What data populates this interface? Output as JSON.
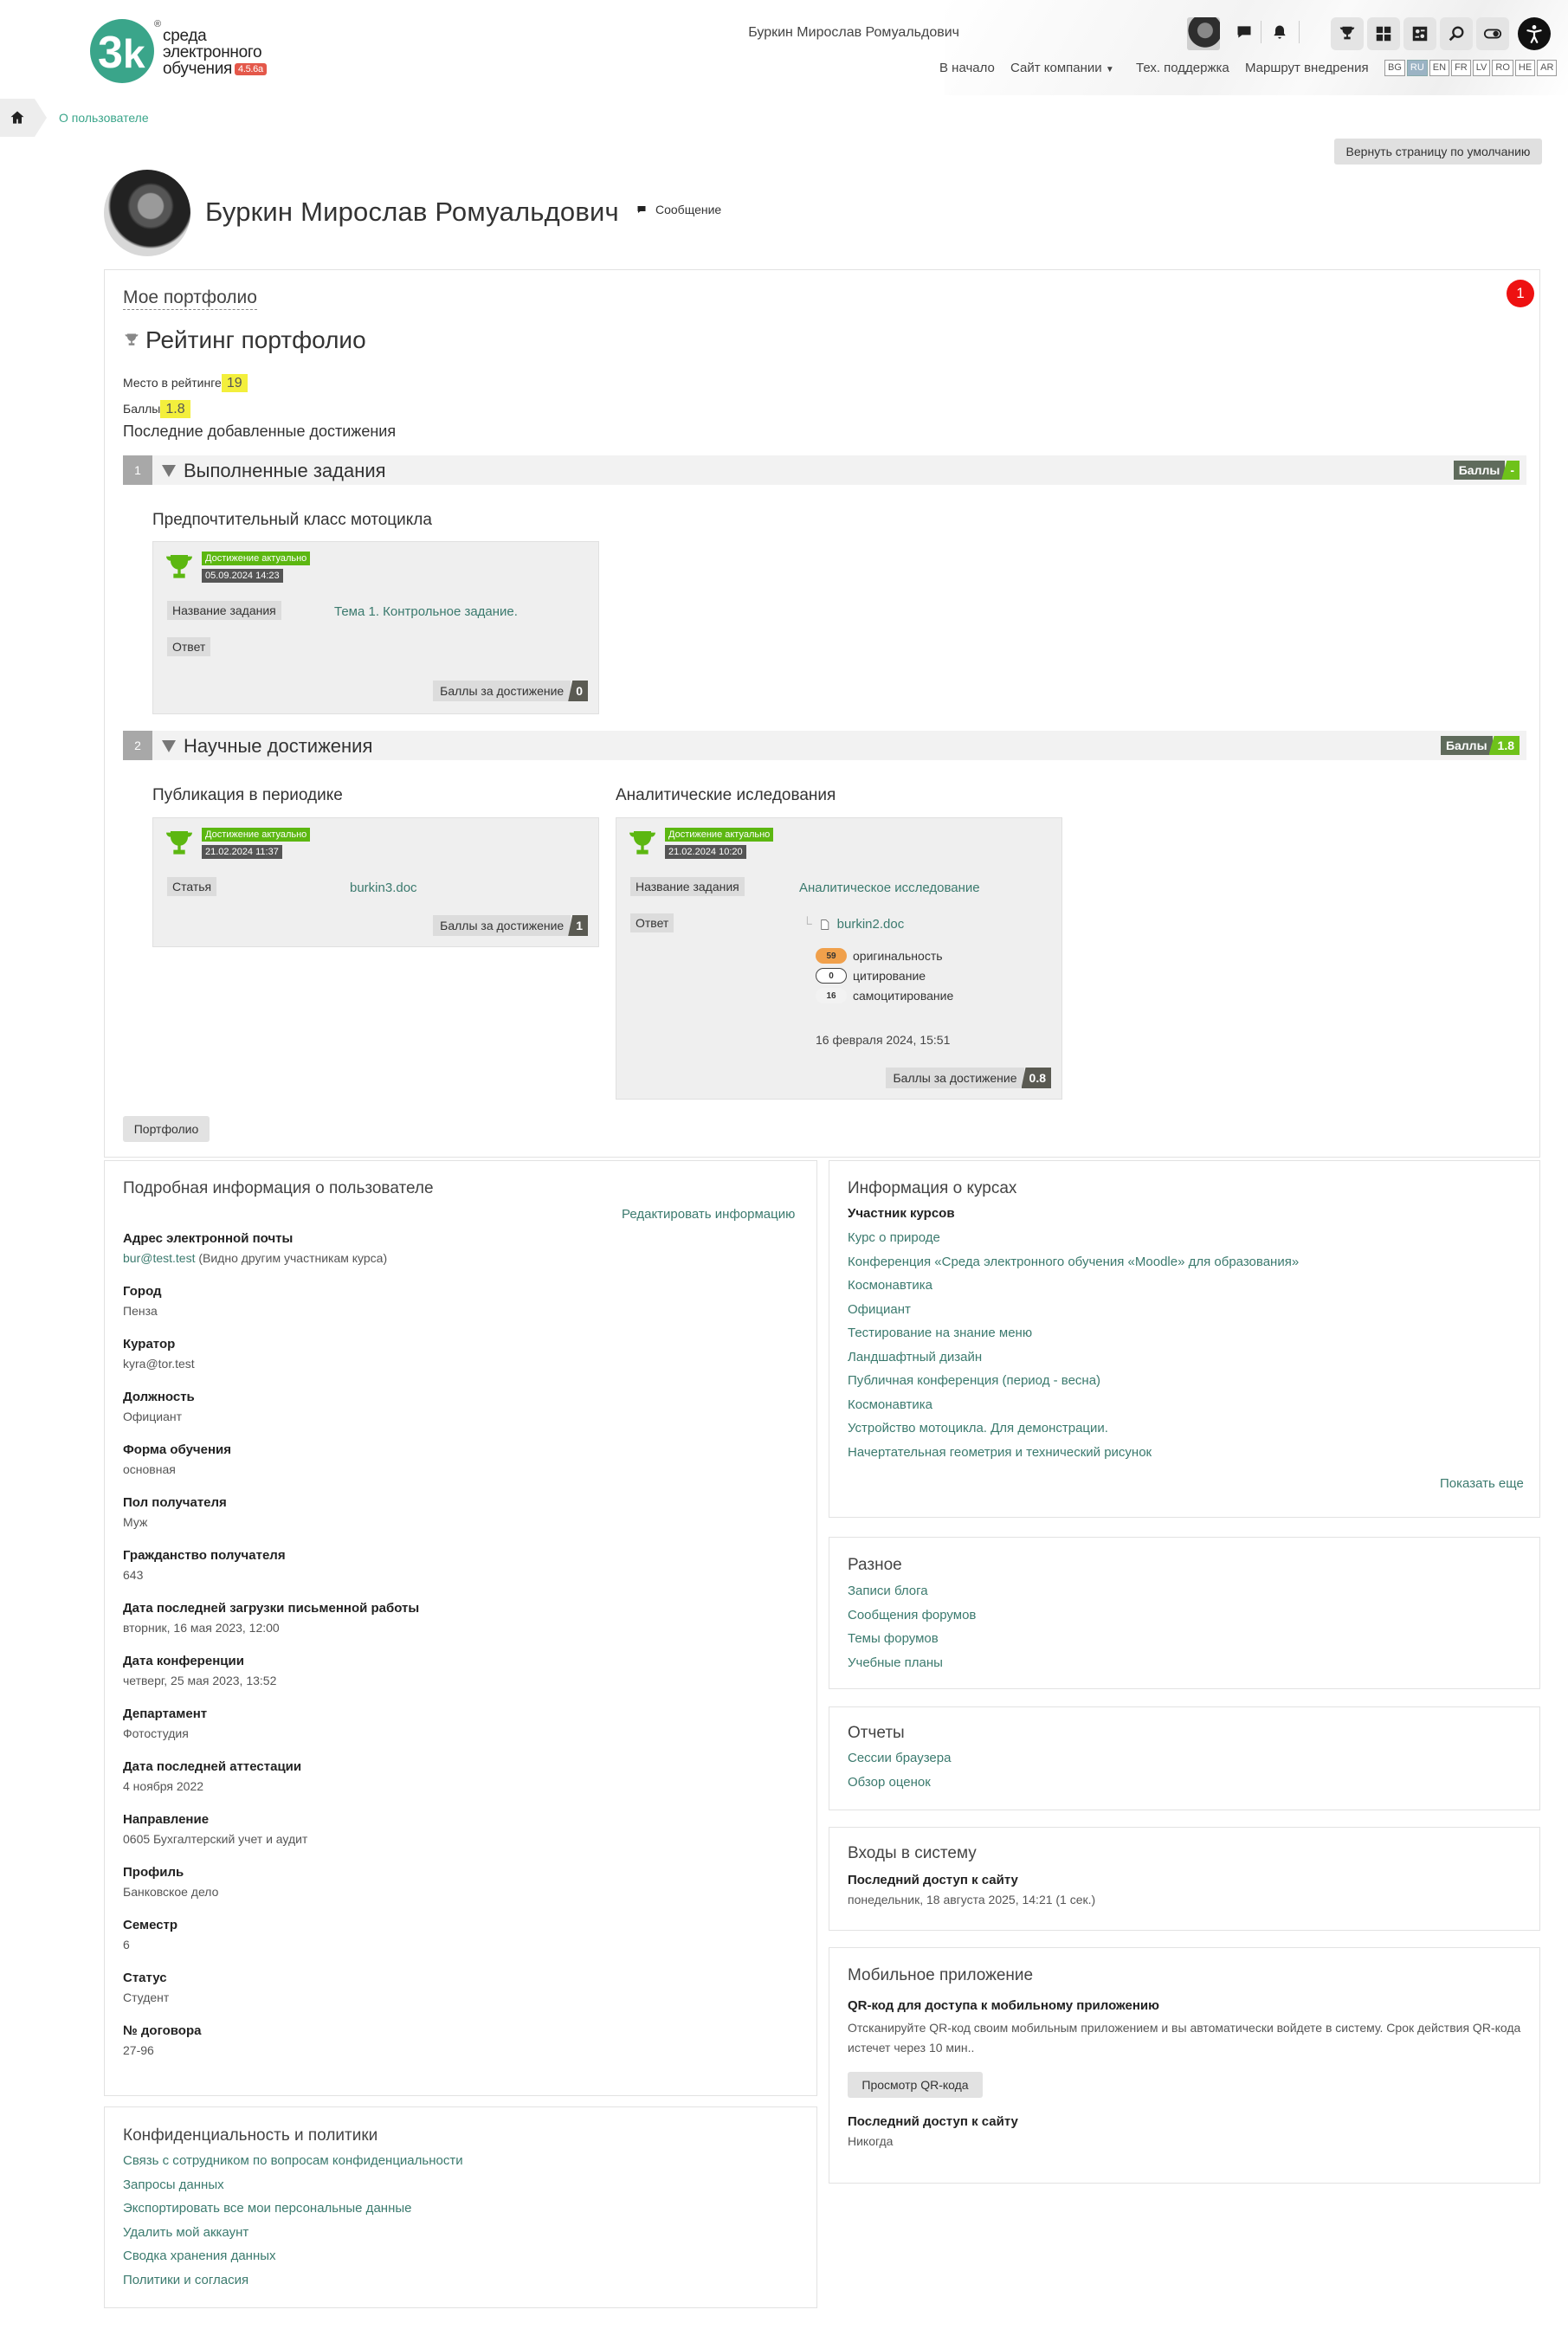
{
  "brand": {
    "name_line1": "среда",
    "name_line2": "электронного",
    "name_line3": "обучения",
    "version": "4.5.6a",
    "logo_letters": "3k",
    "logo_color": "#3aa58a"
  },
  "header": {
    "user_name": "Буркин Мирослав Ромуальдович",
    "nav": {
      "home": "В начало",
      "company_site": "Сайт компании",
      "support": "Тех. поддержка",
      "route": "Маршрут внедрения"
    },
    "languages": [
      "BG",
      "RU",
      "EN",
      "FR",
      "LV",
      "RO",
      "HE",
      "AR"
    ],
    "active_language": "RU"
  },
  "breadcrumb": {
    "current": "О пользователе"
  },
  "reset_button": "Вернуть страницу по умолчанию",
  "profile": {
    "name": "Буркин Мирослав Ромуальдович",
    "message_link": "Сообщение"
  },
  "portfolio": {
    "title": "Мое портфолио",
    "notification_count": "1",
    "rating_title": "Рейтинг портфолио",
    "place_label": "Место в рейтинге",
    "place_value": "19",
    "points_label": "Баллы",
    "points_value": "1.8",
    "last_added": "Последние добавленные достижения",
    "button": "Портфолио",
    "sections": [
      {
        "num": "1",
        "label": "Выполненные задания",
        "score_label": "Баллы",
        "score_value": "-",
        "achievements": [
          {
            "title": "Предпочтительный класс мотоцикла",
            "status": "Достижение актуально",
            "date": "05.09.2024 14:23",
            "field1_label": "Название задания",
            "field1_value": "Тема 1. Контрольное задание.",
            "field2_label": "Ответ",
            "points_label": "Баллы за достижение",
            "points_value": "0"
          }
        ]
      },
      {
        "num": "2",
        "label": "Научные достижения",
        "score_label": "Баллы",
        "score_value": "1.8",
        "achievements": [
          {
            "title": "Публикация в периодике",
            "status": "Достижение актуально",
            "date": "21.02.2024 11:37",
            "field1_label": "Статья",
            "field1_value": "burkin3.doc",
            "points_label": "Баллы за достижение",
            "points_value": "1"
          },
          {
            "title": "Аналитические иследования",
            "status": "Достижение актуально",
            "date": "21.02.2024 10:20",
            "field1_label": "Название задания",
            "field1_value": "Аналитическое исследование",
            "field2_label": "Ответ",
            "file": "burkin2.doc",
            "metrics": [
              {
                "value": "59",
                "label": "оригинальность",
                "color": "#f0a04b"
              },
              {
                "value": "0",
                "label": "цитирование",
                "color": "#ffffff"
              },
              {
                "value": "16",
                "label": "самоцитирование",
                "color": "#f2f2f2"
              }
            ],
            "submitted": "16 февраля 2024, 15:51",
            "points_label": "Баллы за достижение",
            "points_value": "0.8"
          }
        ]
      }
    ]
  },
  "details": {
    "title": "Подробная информация о пользователе",
    "edit_link": "Редактировать информацию",
    "email_label": "Адрес электронной почты",
    "email": "bur@test.test",
    "email_note": " (Видно другим участникам курса)",
    "items": [
      {
        "label": "Город",
        "value": "Пенза"
      },
      {
        "label": "Куратор",
        "value": "kyra@tor.test"
      },
      {
        "label": "Должность",
        "value": "Официант"
      },
      {
        "label": "Форма обучения",
        "value": "основная"
      },
      {
        "label": "Пол получателя",
        "value": "Муж"
      },
      {
        "label": "Гражданство получателя",
        "value": "643"
      },
      {
        "label": "Дата последней загрузки письменной работы",
        "value": "вторник, 16 мая 2023, 12:00"
      },
      {
        "label": "Дата конференции",
        "value": "четверг, 25 мая 2023, 13:52"
      },
      {
        "label": "Департамент",
        "value": "Фотостудия"
      },
      {
        "label": "Дата последней аттестации",
        "value": "4 ноября 2022"
      },
      {
        "label": "Направление",
        "value": "0605 Бухгалтерский учет и аудит"
      },
      {
        "label": "Профиль",
        "value": "Банковское дело"
      },
      {
        "label": "Семестр",
        "value": "6"
      },
      {
        "label": "Статус",
        "value": "Студент"
      },
      {
        "label": "№ договора",
        "value": "27-96"
      }
    ]
  },
  "privacy": {
    "title": "Конфиденциальность и политики",
    "links": [
      "Связь с сотрудником по вопросам конфиденциальности",
      "Запросы данных",
      "Экспортировать все мои персональные данные",
      "Удалить мой аккаунт",
      "Сводка хранения данных",
      "Политики и согласия"
    ]
  },
  "courses": {
    "title": "Информация о курсах",
    "subtitle": "Участник курсов",
    "links": [
      "Курс о природе",
      "Конференция «Среда электронного обучения «Moodle» для образования»",
      "Космонавтика",
      "Официант",
      "Тестирование на знание меню",
      "Ландшафтный дизайн",
      "Публичная конференция (период - весна)",
      "Космонавтика",
      "Устройство мотоцикла. Для демонстрации.",
      "Начертательная геометрия и технический рисунок"
    ],
    "show_more": "Показать еще"
  },
  "misc": {
    "title": "Разное",
    "links": [
      "Записи блога",
      "Сообщения форумов",
      "Темы форумов",
      "Учебные планы"
    ]
  },
  "reports": {
    "title": "Отчеты",
    "links": [
      "Сессии браузера",
      "Обзор оценок"
    ]
  },
  "logins": {
    "title": "Входы в систему",
    "last_access_label": "Последний доступ к сайту",
    "last_access_value": "понедельник, 18 августа 2025, 14:21  (1 сек.)"
  },
  "mobile": {
    "title": "Мобильное приложение",
    "qr_label": "QR-код для доступа к мобильному приложению",
    "qr_text": "Отсканируйте QR-код своим мобильным приложением и вы автоматически войдете в систему. Срок действия QR-кода истечет через 10 мин..",
    "qr_button": "Просмотр QR-кода",
    "last_access_label": "Последний доступ к сайту",
    "last_access_value": "Никогда"
  }
}
